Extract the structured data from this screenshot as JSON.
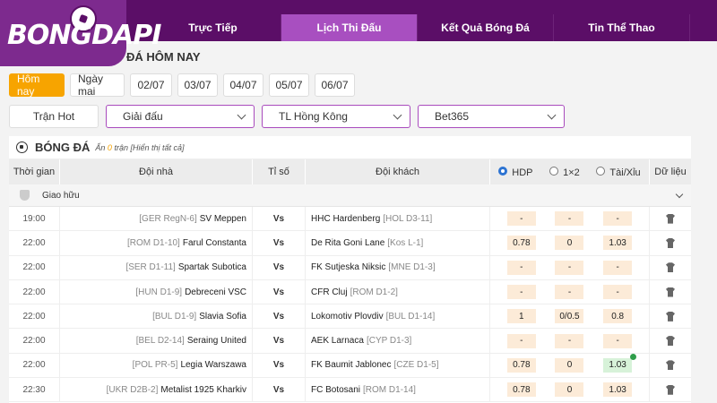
{
  "logo": {
    "text": "BONGDAPI"
  },
  "nav": [
    "Trực Tiếp",
    "Lịch Thi Đấu",
    "Kết Quả Bóng Đá",
    "Tin Thể Thao"
  ],
  "section_title": "ĐÁ HÔM NAY",
  "days": [
    "Hôm nay",
    "Ngày mai",
    "02/07",
    "03/07",
    "04/07",
    "05/07",
    "06/07"
  ],
  "filters": {
    "hot": "Trận Hot",
    "league": "Giải đấu",
    "timezone": "TL Hồng Kông",
    "bookmaker": "Bet365"
  },
  "panel": {
    "title": "BÓNG ĐÁ",
    "hide_prefix": "Ẩn",
    "hide_count": "0",
    "hide_suffix": "trận [Hiển thị tất cả]"
  },
  "headers": {
    "time": "Thời gian",
    "home": "Đội nhà",
    "score": "Tỉ số",
    "away": "Đội khách",
    "hdp": "HDP",
    "x12": "1×2",
    "ou": "Tài/Xỉu",
    "data": "Dữ liệu"
  },
  "league": "Giao hữu",
  "matches": [
    {
      "time": "19:00",
      "home_rank": "[GER RegN-6]",
      "home": "SV Meppen",
      "vs": "Vs",
      "away": "HHC Hardenberg",
      "away_rank": "[HOL D3-11]",
      "o1": "-",
      "o2": "-",
      "o3": "-"
    },
    {
      "time": "22:00",
      "home_rank": "[ROM D1-10]",
      "home": "Farul Constanta",
      "vs": "Vs",
      "away": "De Rita Goni Lane",
      "away_rank": "[Kos L-1]",
      "o1": "0.78",
      "o2": "0",
      "o3": "1.03"
    },
    {
      "time": "22:00",
      "home_rank": "[SER D1-11]",
      "home": "Spartak Subotica",
      "vs": "Vs",
      "away": "FK Sutjeska Niksic",
      "away_rank": "[MNE D1-3]",
      "o1": "-",
      "o2": "-",
      "o3": "-"
    },
    {
      "time": "22:00",
      "home_rank": "[HUN D1-9]",
      "home": "Debreceni VSC",
      "vs": "Vs",
      "away": "CFR Cluj",
      "away_rank": "[ROM D1-2]",
      "o1": "-",
      "o2": "-",
      "o3": "-"
    },
    {
      "time": "22:00",
      "home_rank": "[BUL D1-9]",
      "home": "Slavia Sofia",
      "vs": "Vs",
      "away": "Lokomotiv Plovdiv",
      "away_rank": "[BUL D1-14]",
      "o1": "1",
      "o2": "0/0.5",
      "o3": "0.8"
    },
    {
      "time": "22:00",
      "home_rank": "[BEL D2-14]",
      "home": "Seraing United",
      "vs": "Vs",
      "away": "AEK Larnaca",
      "away_rank": "[CYP D1-3]",
      "o1": "-",
      "o2": "-",
      "o3": "-"
    },
    {
      "time": "22:00",
      "home_rank": "[POL PR-5]",
      "home": "Legia Warszawa",
      "vs": "Vs",
      "away": "FK Baumit Jablonec",
      "away_rank": "[CZE D1-5]",
      "o1": "0.78",
      "o2": "0",
      "o3": "1.03"
    },
    {
      "time": "22:30",
      "home_rank": "[UKR D2B-2]",
      "home": "Metalist 1925 Kharkiv",
      "vs": "Vs",
      "away": "FC Botosani",
      "away_rank": "[ROM D1-14]",
      "o1": "0.78",
      "o2": "0",
      "o3": "1.03"
    }
  ]
}
